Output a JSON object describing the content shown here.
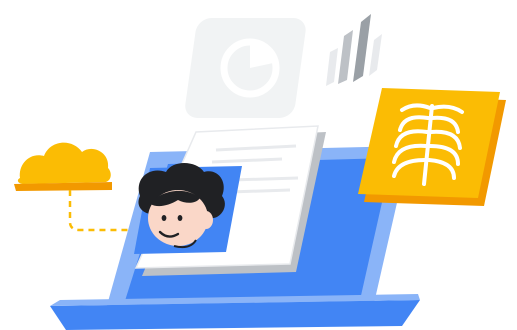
{
  "icons": {
    "cloud": "cloud-icon",
    "pie_chart": "pie-chart-icon",
    "bar_chart": "bar-chart-icon",
    "xray": "xray-ribcage-icon",
    "avatar": "doctor-avatar-icon",
    "laptop": "laptop-icon",
    "document": "document-icon"
  },
  "colors": {
    "brand_blue": "#4285F4",
    "light_blue": "#8AB4F8",
    "yellow": "#FBBC04",
    "orange": "#F29900",
    "light_gray": "#F1F3F4",
    "mid_gray": "#BDC1C6",
    "dark_gray": "#9AA0A6",
    "hair": "#202124",
    "skin": "#FAD7C8"
  }
}
